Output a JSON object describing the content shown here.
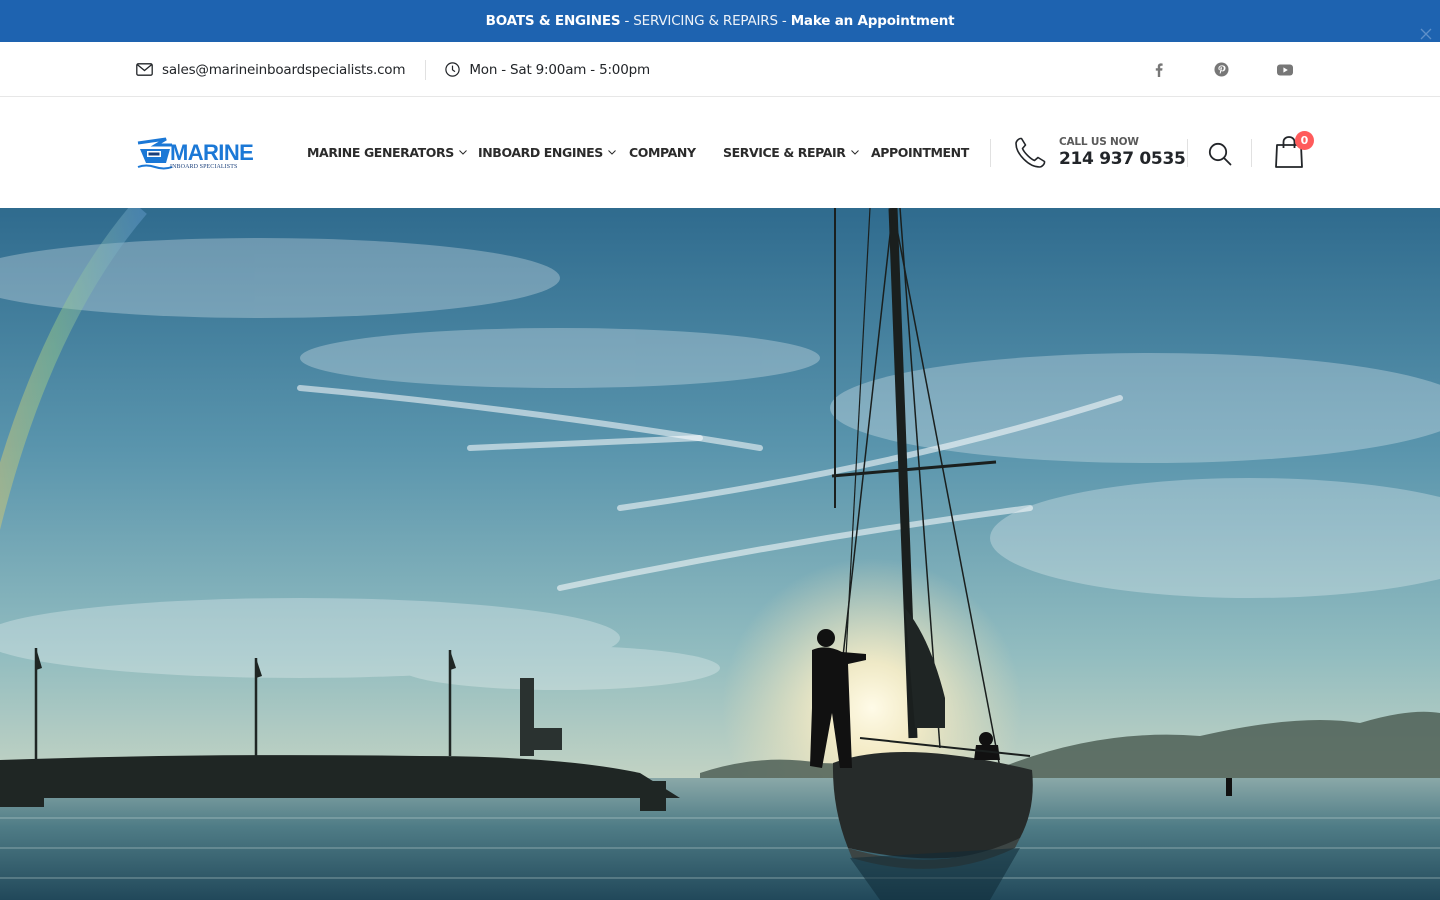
{
  "promo": {
    "part1": "BOATS & ENGINES",
    "sep1": " - ",
    "part2": "SERVICING & REPAIRS",
    "sep2": " - ",
    "part3": "Make an Appointment",
    "close_icon": "close-icon"
  },
  "contact": {
    "email": "sales@marineinboardspecialists.com",
    "hours": "Mon - Sat 9:00am - 5:00pm"
  },
  "social": [
    {
      "name": "facebook-icon"
    },
    {
      "name": "pinterest-icon"
    },
    {
      "name": "youtube-icon"
    }
  ],
  "logo": {
    "word": "MARINE",
    "sub": "INBOARD SPECIALISTS"
  },
  "nav": {
    "items": [
      {
        "label": "MARINE GENERATORS",
        "has_dropdown": true
      },
      {
        "label": "INBOARD ENGINES",
        "has_dropdown": true
      },
      {
        "label": "COMPANY",
        "has_dropdown": false
      },
      {
        "label": "SERVICE & REPAIR",
        "has_dropdown": true
      },
      {
        "label": "APPOINTMENT",
        "has_dropdown": false
      }
    ]
  },
  "call": {
    "label": "CALL US NOW",
    "number": "214 937 0535"
  },
  "cart": {
    "count": "0"
  },
  "colors": {
    "brand_blue": "#1e63b0",
    "logo_blue": "#1b78d6",
    "badge_red": "#ff5b5b",
    "text_dark": "#222529"
  },
  "hero": {
    "scene": "sailboat-at-sunset"
  }
}
